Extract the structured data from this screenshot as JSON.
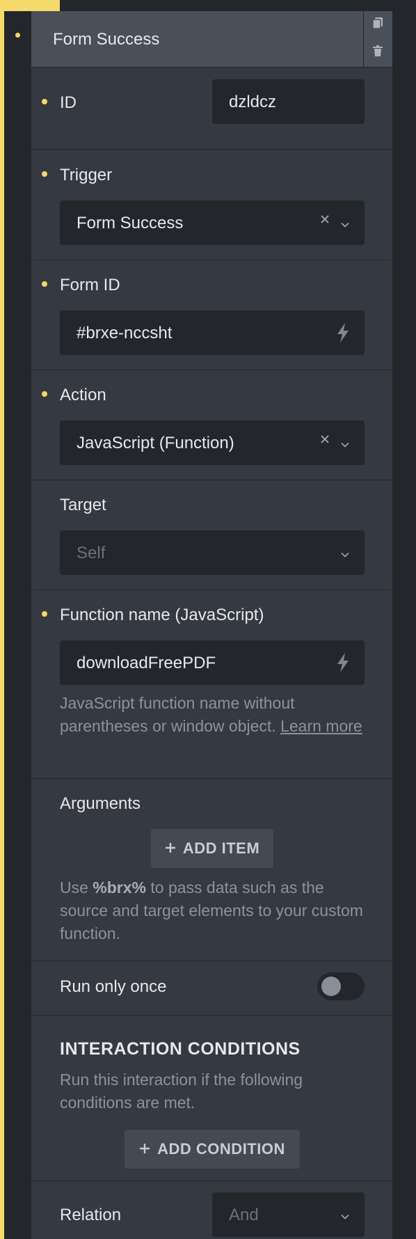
{
  "header": {
    "title": "Form Success",
    "actions": [
      "copy-icon",
      "trash-icon"
    ]
  },
  "fields": {
    "id": {
      "label": "ID",
      "value": "dzldcz"
    },
    "trigger": {
      "label": "Trigger",
      "value": "Form Success"
    },
    "form_id": {
      "label": "Form ID",
      "value": "#brxe-nccsht"
    },
    "action": {
      "label": "Action",
      "value": "JavaScript (Function)"
    },
    "target": {
      "label": "Target",
      "placeholder": "Self"
    },
    "function_name": {
      "label": "Function name (JavaScript)",
      "value": "downloadFreePDF",
      "help_text": "JavaScript function name without parentheses or window object.",
      "help_link": "Learn more"
    },
    "arguments": {
      "label": "Arguments",
      "add_label": "ADD ITEM",
      "help_prefix": "Use",
      "help_code": "%brx%",
      "help_suffix": "to pass data such as the source and target elements to your custom function."
    },
    "run_only_once": {
      "label": "Run only once",
      "enabled": false
    },
    "interaction_conditions": {
      "heading": "INTERACTION CONDITIONS",
      "description": "Run this interaction if the following conditions are met.",
      "add_label": "ADD CONDITION"
    },
    "relation": {
      "label": "Relation",
      "placeholder": "And"
    }
  },
  "colors": {
    "accent": "#f4d96b",
    "panel": "#353941",
    "header": "#4a5059",
    "input": "#23262b"
  }
}
